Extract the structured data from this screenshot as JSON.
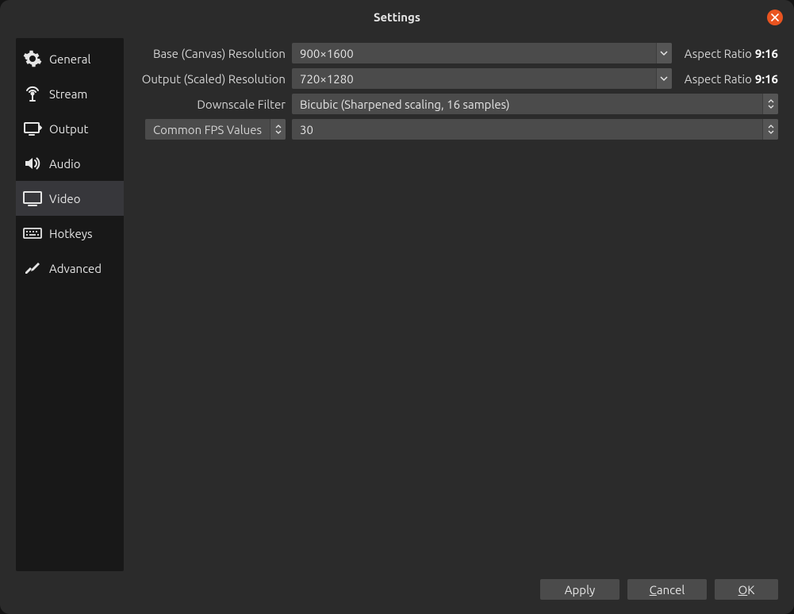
{
  "title": "Settings",
  "sidebar": {
    "items": [
      {
        "label": "General"
      },
      {
        "label": "Stream"
      },
      {
        "label": "Output"
      },
      {
        "label": "Audio"
      },
      {
        "label": "Video"
      },
      {
        "label": "Hotkeys"
      },
      {
        "label": "Advanced"
      }
    ],
    "selected_index": 4
  },
  "video": {
    "base_label": "Base (Canvas) Resolution",
    "base_value": "900×1600",
    "base_aspect_label": "Aspect Ratio",
    "base_aspect_value": "9:16",
    "output_label": "Output (Scaled) Resolution",
    "output_value": "720×1280",
    "output_aspect_label": "Aspect Ratio",
    "output_aspect_value": "9:16",
    "downscale_label": "Downscale Filter",
    "downscale_value": "Bicubic (Sharpened scaling, 16 samples)",
    "fps_mode_label": "Common FPS Values",
    "fps_value": "30"
  },
  "buttons": {
    "apply": "Apply",
    "cancel": "Cancel",
    "ok": "OK"
  }
}
